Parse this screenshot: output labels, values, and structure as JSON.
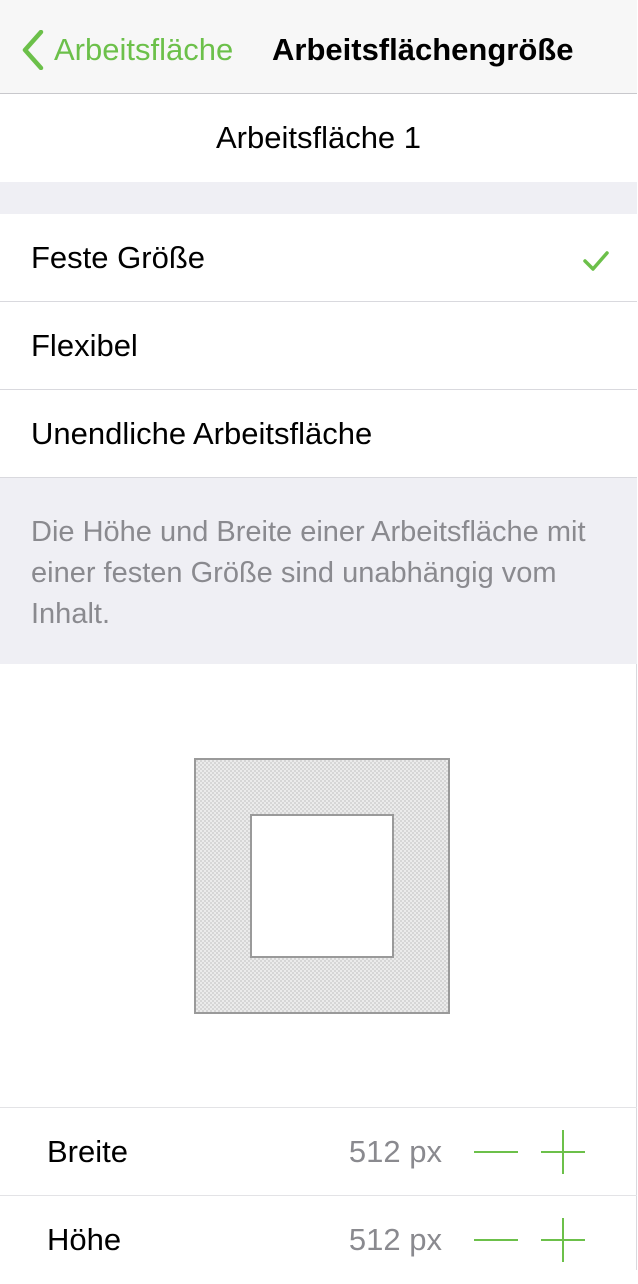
{
  "navbar": {
    "back_label": "Arbeitsfläche",
    "title": "Arbeitsflächengröße"
  },
  "artboard": {
    "name": "Arbeitsfläche 1"
  },
  "size_options": [
    {
      "label": "Feste Größe",
      "selected": true
    },
    {
      "label": "Flexibel",
      "selected": false
    },
    {
      "label": "Unendliche Arbeitsfläche",
      "selected": false
    }
  ],
  "description": "Die Höhe und Breite einer Arbeitsfläche mit einer festen Größe sind unabhängig vom Inhalt.",
  "dimensions": {
    "width": {
      "label": "Breite",
      "value": "512 px"
    },
    "height": {
      "label": "Höhe",
      "value": "512 px"
    }
  },
  "colors": {
    "accent": "#6cc04a",
    "secondary_text": "#8a8a8f",
    "group_background": "#efeff4"
  },
  "icons": {
    "back": "chevron-left-icon",
    "selected": "checkmark-icon",
    "decrement": "minus-icon",
    "increment": "plus-icon"
  }
}
